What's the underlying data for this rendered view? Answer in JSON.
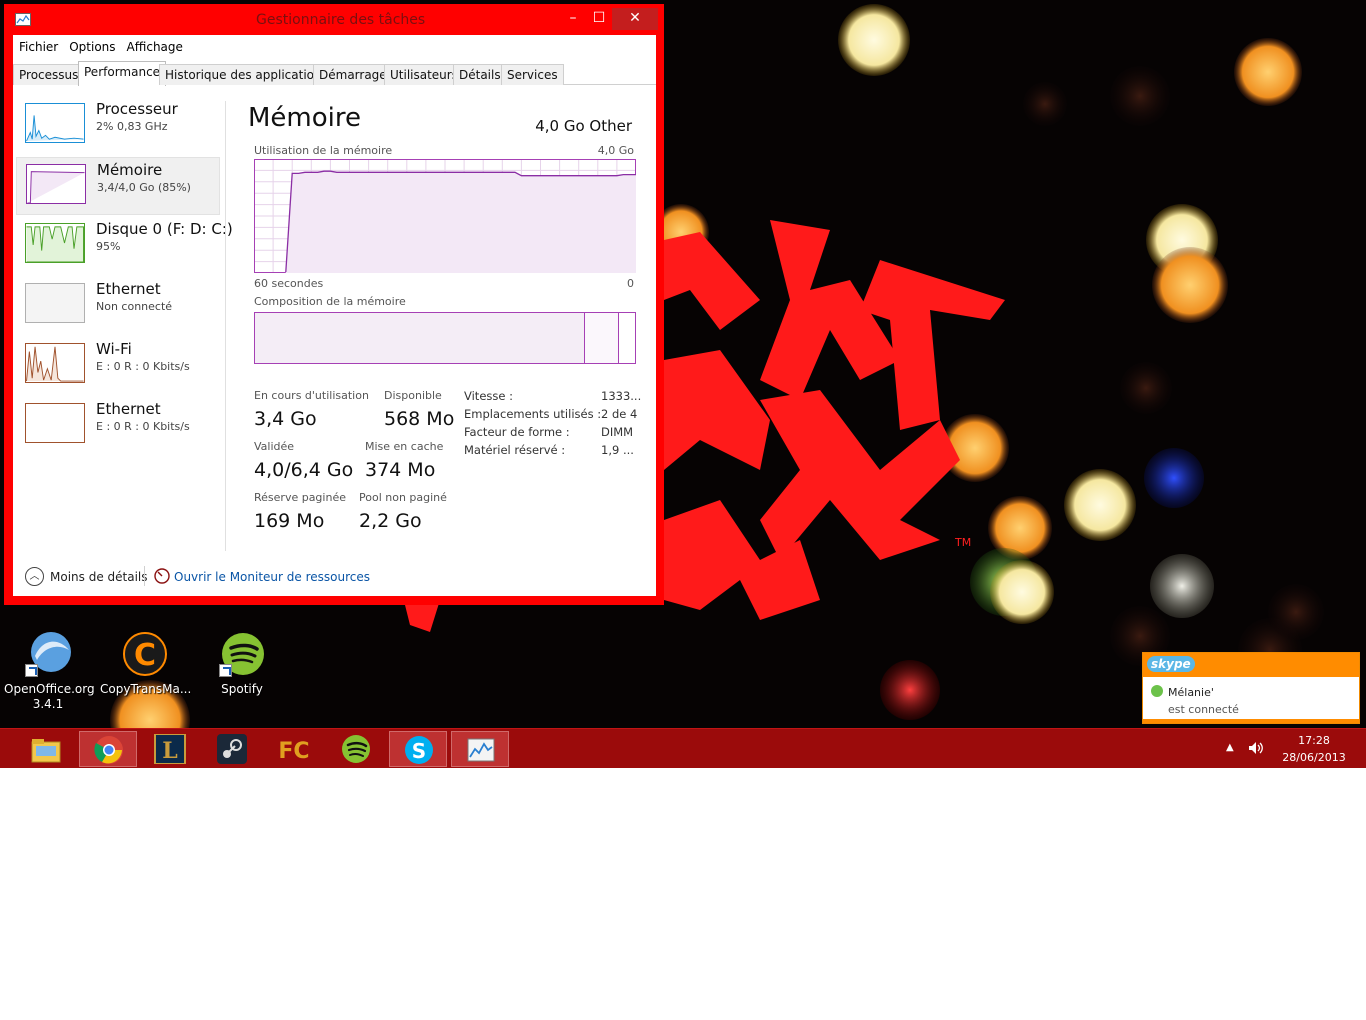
{
  "window": {
    "title": "Gestionnaire des tâches",
    "minimize": "–",
    "maximize": "☐",
    "close": "✕",
    "menu": [
      "Fichier",
      "Options",
      "Affichage"
    ],
    "tabs": [
      "Processus",
      "Performance",
      "Historique des applications",
      "Démarrage",
      "Utilisateurs",
      "Détails",
      "Services"
    ],
    "active_tab": "Performance"
  },
  "sidebar": {
    "items": [
      {
        "name": "Processeur",
        "sub": "2% 0,83 GHz",
        "color": "#1a8fd6"
      },
      {
        "name": "Mémoire",
        "sub": "3,4/4,0 Go (85%)",
        "color": "#8b2ea5",
        "selected": true
      },
      {
        "name": "Disque 0 (F: D: C:)",
        "sub": "95%",
        "color": "#4aa028"
      },
      {
        "name": "Ethernet",
        "sub": "Non connecté",
        "color": "#b0b0b0"
      },
      {
        "name": "Wi-Fi",
        "sub": "E : 0 R : 0 Kbits/s",
        "color": "#a0522d"
      },
      {
        "name": "Ethernet",
        "sub": "E : 0 R : 0 Kbits/s",
        "color": "#a0522d"
      }
    ]
  },
  "memory": {
    "title": "Mémoire",
    "total": "4,0 Go Other",
    "usage_label": "Utilisation de la mémoire",
    "usage_max": "4,0 Go",
    "time_left": "60 secondes",
    "time_right": "0",
    "composition_label": "Composition de la mémoire",
    "usage_series": [
      0,
      0,
      0,
      0,
      0,
      0,
      0.88,
      0.88,
      0.89,
      0.89,
      0.89,
      0.9,
      0.9,
      0.89,
      0.89,
      0.89,
      0.89,
      0.89,
      0.89,
      0.89,
      0.89,
      0.89,
      0.89,
      0.89,
      0.89,
      0.89,
      0.89,
      0.89,
      0.89,
      0.89,
      0.89,
      0.89,
      0.89,
      0.89,
      0.89,
      0.89,
      0.89,
      0.89,
      0.89,
      0.89,
      0.89,
      0.89,
      0.86,
      0.86,
      0.86,
      0.86,
      0.86,
      0.86,
      0.86,
      0.86,
      0.86,
      0.86,
      0.86,
      0.86,
      0.86,
      0.86,
      0.86,
      0.86,
      0.87,
      0.87,
      0.87
    ],
    "stats": {
      "in_use_label": "En cours d'utilisation",
      "in_use": "3,4 Go",
      "available_label": "Disponible",
      "available": "568 Mo",
      "committed_label": "Validée",
      "committed": "4,0/6,4 Go",
      "cached_label": "Mise en cache",
      "cached": "374 Mo",
      "paged_label": "Réserve paginée",
      "paged": "169 Mo",
      "nonpaged_label": "Pool non paginé",
      "nonpaged": "2,2 Go"
    },
    "hardware": [
      {
        "label": "Vitesse :",
        "value": "1333..."
      },
      {
        "label": "Emplacements utilisés :",
        "value": "2 de 4"
      },
      {
        "label": "Facteur de forme :",
        "value": "DIMM"
      },
      {
        "label": "Matériel réservé :",
        "value": "1,9 ..."
      }
    ]
  },
  "footer": {
    "less_details": "Moins de détails",
    "resmon_link": "Ouvrir le Moniteur de ressources"
  },
  "desktop_icons": [
    {
      "label": "OpenOffice.org 3.4.1",
      "icon": "openoffice-icon"
    },
    {
      "label": "CopyTransMa...",
      "icon": "copytrans-icon"
    },
    {
      "label": "Spotify",
      "icon": "spotify-icon"
    }
  ],
  "toast": {
    "app": "skype",
    "name": "Mélanie'",
    "status": "est connecté"
  },
  "taskbar": {
    "apps": [
      "file-explorer-icon",
      "chrome-icon",
      "league-of-legends-icon",
      "steam-icon",
      "fc-icon",
      "spotify-icon",
      "skype-icon",
      "task-manager-icon"
    ],
    "time": "17:28",
    "date": "28/06/2013"
  },
  "colors": {
    "window_frame": "#ff0000",
    "taskbar": "#9b0b0b",
    "memory_accent": "#8b2ea5",
    "link": "#0a55a6",
    "toast_accent": "#ff8c00"
  }
}
